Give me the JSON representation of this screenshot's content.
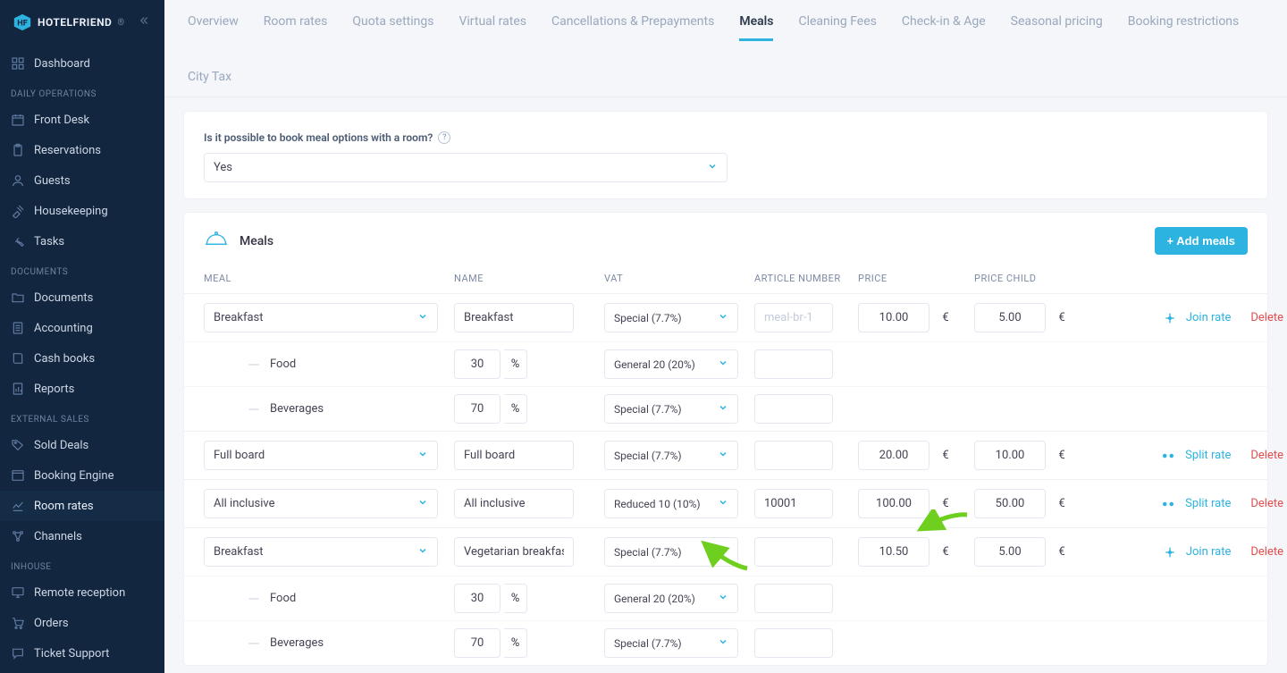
{
  "brand": {
    "name": "HOTELFRIEND",
    "mark_bg": "#2db3e0"
  },
  "sidebar": {
    "sections": [
      {
        "label": null,
        "items": [
          {
            "label": "Dashboard",
            "icon": "dashboard"
          }
        ]
      },
      {
        "label": "DAILY OPERATIONS",
        "items": [
          {
            "label": "Front Desk",
            "icon": "calendar"
          },
          {
            "label": "Reservations",
            "icon": "clipboard"
          },
          {
            "label": "Guests",
            "icon": "user"
          },
          {
            "label": "Housekeeping",
            "icon": "broom"
          },
          {
            "label": "Tasks",
            "icon": "wrench"
          }
        ]
      },
      {
        "label": "DOCUMENTS",
        "items": [
          {
            "label": "Documents",
            "icon": "folder"
          },
          {
            "label": "Accounting",
            "icon": "calc"
          },
          {
            "label": "Cash books",
            "icon": "book"
          },
          {
            "label": "Reports",
            "icon": "report"
          }
        ]
      },
      {
        "label": "EXTERNAL SALES",
        "items": [
          {
            "label": "Sold Deals",
            "icon": "tag"
          },
          {
            "label": "Booking Engine",
            "icon": "window"
          },
          {
            "label": "Room rates",
            "icon": "chart",
            "active": true
          },
          {
            "label": "Channels",
            "icon": "nodes"
          }
        ]
      },
      {
        "label": "INHOUSE",
        "items": [
          {
            "label": "Remote reception",
            "icon": "monitor"
          },
          {
            "label": "Orders",
            "icon": "cart"
          },
          {
            "label": "Ticket Support",
            "icon": "chat"
          }
        ]
      }
    ]
  },
  "tabs": [
    {
      "label": "Overview"
    },
    {
      "label": "Room rates"
    },
    {
      "label": "Quota settings"
    },
    {
      "label": "Virtual rates"
    },
    {
      "label": "Cancellations & Prepayments"
    },
    {
      "label": "Meals",
      "active": true
    },
    {
      "label": "Cleaning Fees"
    },
    {
      "label": "Check-in & Age"
    },
    {
      "label": "Seasonal pricing"
    },
    {
      "label": "Booking restrictions"
    },
    {
      "label": "City Tax"
    }
  ],
  "question": {
    "label": "Is it possible to book meal options with a room?",
    "value": "Yes"
  },
  "meals": {
    "section_title": "Meals",
    "add_button": "+ Add meals",
    "columns": {
      "meal": "MEAL",
      "name": "NAME",
      "vat": "VAT",
      "article": "ARTICLE NUMBER",
      "price": "PRICE",
      "price_child": "PRICE CHILD"
    },
    "currency": "€",
    "pct_unit": "%",
    "actions": {
      "join": "Join rate",
      "split": "Split rate",
      "delete": "Delete"
    },
    "rows": [
      {
        "meal": "Breakfast",
        "name": "Breakfast",
        "vat": "Special (7.7%)",
        "article": "",
        "article_placeholder": "meal-br-1",
        "price": "10.00",
        "price_child": "5.00",
        "action": "join",
        "subs": [
          {
            "label": "Food",
            "pct": "30",
            "vat": "General 20 (20%)",
            "article": ""
          },
          {
            "label": "Beverages",
            "pct": "70",
            "vat": "Special (7.7%)",
            "article": ""
          }
        ]
      },
      {
        "meal": "Full board",
        "name": "Full board",
        "vat": "Special (7.7%)",
        "article": "",
        "price": "20.00",
        "price_child": "10.00",
        "action": "split"
      },
      {
        "meal": "All inclusive",
        "name": "All inclusive",
        "vat": "Reduced 10 (10%)",
        "article": "10001",
        "price": "100.00",
        "price_child": "50.00",
        "action": "split"
      },
      {
        "meal": "Breakfast",
        "name": "Vegetarian breakfast",
        "vat": "Special (7.7%)",
        "article": "",
        "price": "10.50",
        "price_child": "5.00",
        "action": "join",
        "subs": [
          {
            "label": "Food",
            "pct": "30",
            "vat": "General 20 (20%)",
            "article": ""
          },
          {
            "label": "Beverages",
            "pct": "70",
            "vat": "Special (7.7%)",
            "article": ""
          }
        ]
      }
    ]
  }
}
